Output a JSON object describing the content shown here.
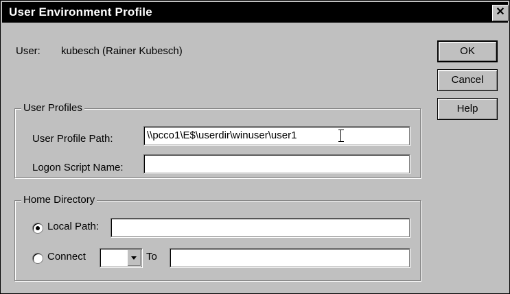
{
  "window": {
    "title": "User Environment Profile",
    "close_label": "✕"
  },
  "user": {
    "label": "User:",
    "value": "kubesch (Rainer Kubesch)"
  },
  "buttons": {
    "ok": "OK",
    "cancel": "Cancel",
    "help": "Help"
  },
  "profiles": {
    "legend": "User Profiles",
    "profile_path_label": "User Profile Path:",
    "profile_path_value": "\\\\pcco1\\E$\\userdir\\winuser\\user1",
    "logon_script_label": "Logon Script Name:",
    "logon_script_value": ""
  },
  "home": {
    "legend": "Home Directory",
    "local_path_label": "Local Path:",
    "local_path_value": "",
    "local_path_selected": true,
    "connect_label": "Connect",
    "connect_drive": "",
    "to_label": "To",
    "connect_to_value": ""
  }
}
